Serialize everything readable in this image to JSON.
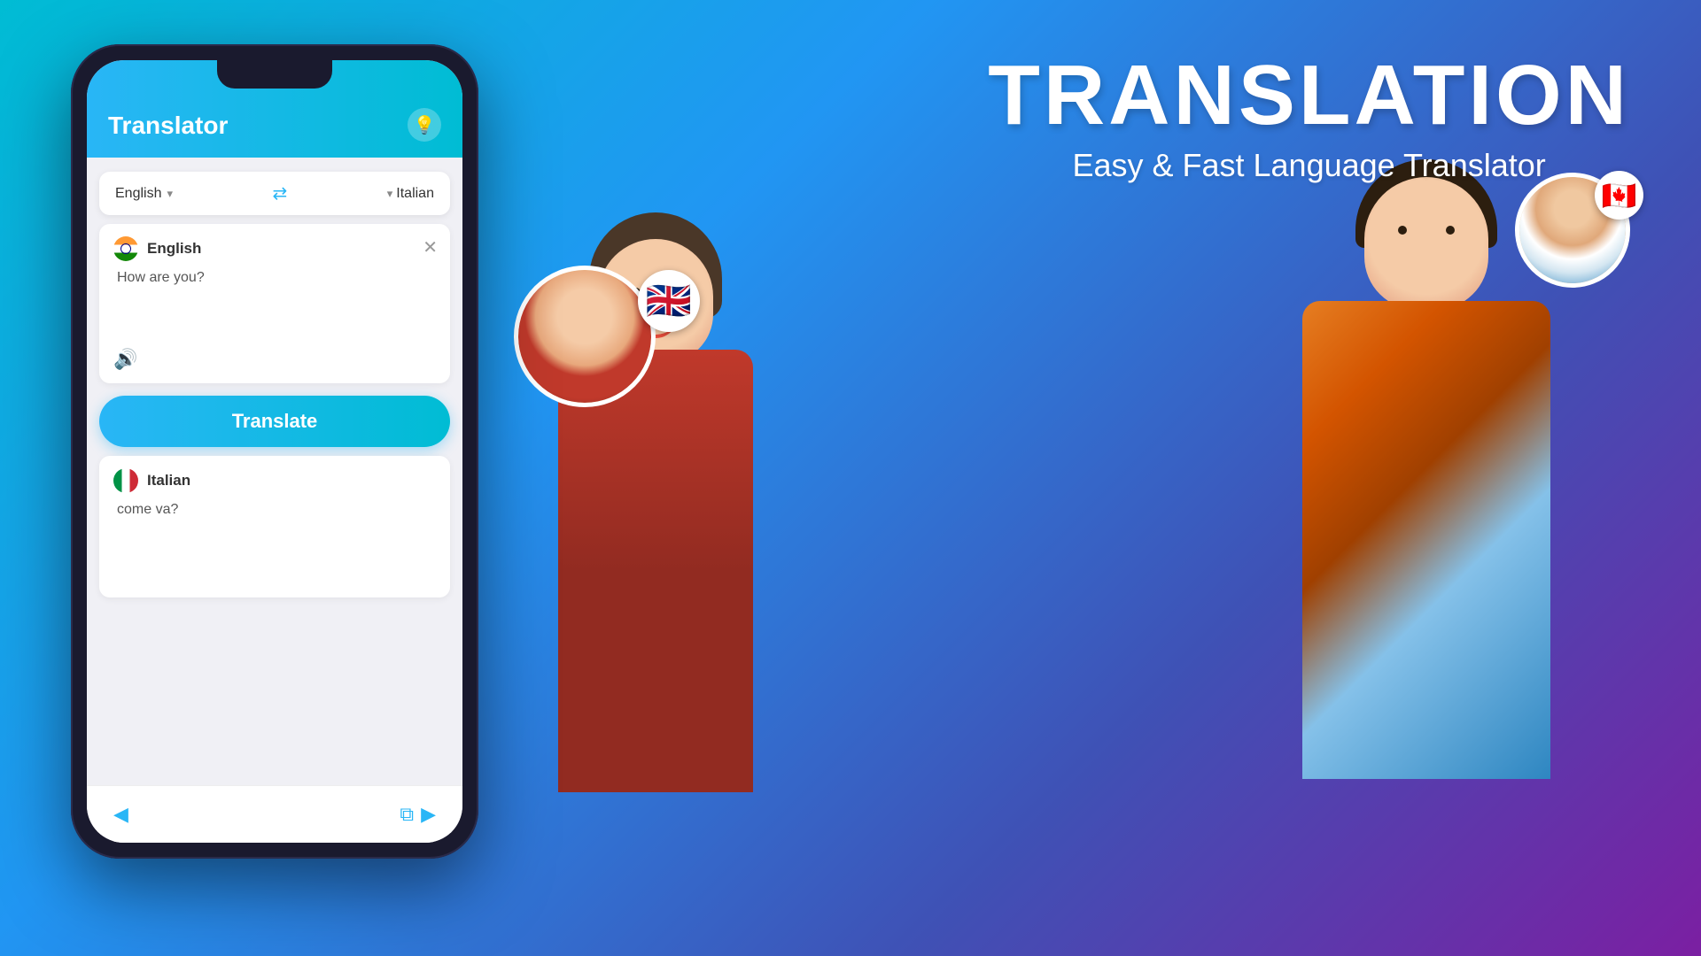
{
  "background": {
    "gradient_start": "#00bcd4",
    "gradient_end": "#7b1fa2"
  },
  "right_panel": {
    "main_title": "TRANSLATION",
    "subtitle": "Easy & Fast Language Translator"
  },
  "phone": {
    "app_title": "Translator",
    "lightbulb_label": "💡",
    "source_language": "English",
    "target_language": "Italian",
    "source_chevron": "▾",
    "target_chevron": "▾",
    "swap_icon": "⇄",
    "input_flag": "🇮🇳",
    "input_lang_label": "English",
    "input_text": "How are you?",
    "close_icon": "✕",
    "speaker_icon": "🔊",
    "translate_button_label": "Translate",
    "output_flag": "🇮🇹",
    "output_lang_label": "Italian",
    "output_text": "come va?",
    "bottom_icons": {
      "back": "◀",
      "copy": "⧉",
      "share": "▶"
    }
  },
  "avatars": {
    "uk_flag": "🇬🇧",
    "canada_flag": "🇨🇦"
  }
}
